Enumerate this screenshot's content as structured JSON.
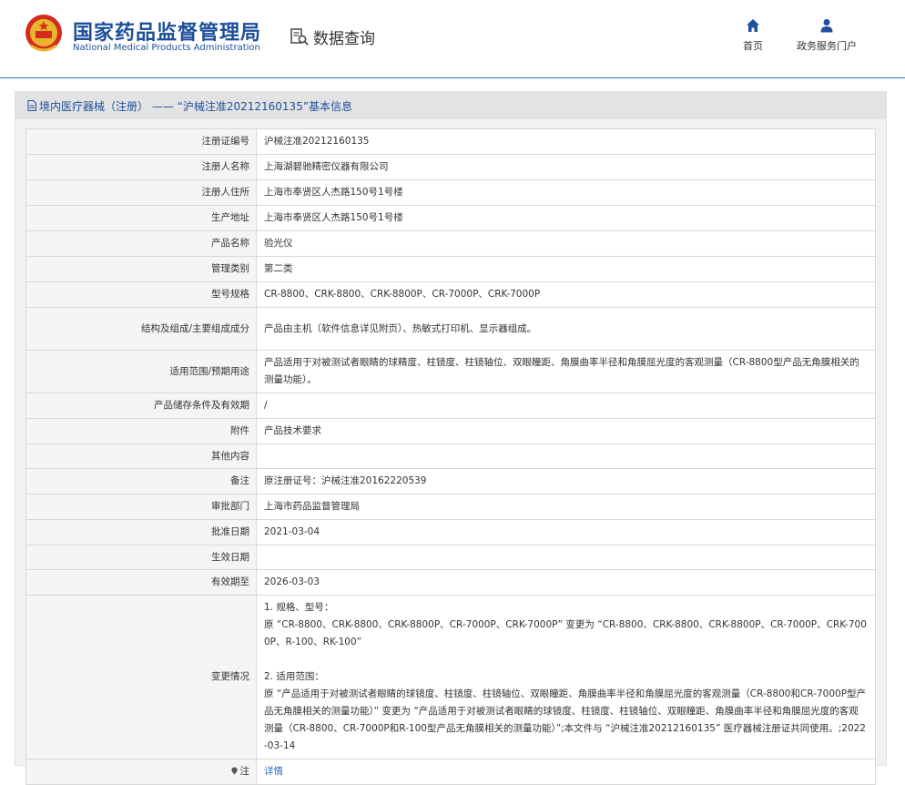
{
  "header": {
    "logo_cn": "国家药品监督管理局",
    "logo_en": "National Medical Products Administration",
    "query_label": "数据查询",
    "nav": [
      {
        "label": "首页",
        "icon": "home-icon"
      },
      {
        "label": "政务服务门户",
        "icon": "user-icon"
      }
    ]
  },
  "panel": {
    "title": "境内医疗器械（注册） —— “沪械注准20212160135”基本信息"
  },
  "rows": [
    {
      "label": "注册证编号",
      "value": "沪械注准20212160135"
    },
    {
      "label": "注册人名称",
      "value": "上海湖碧驰精密仪器有限公司"
    },
    {
      "label": "注册人住所",
      "value": "上海市奉贤区人杰路150号1号楼"
    },
    {
      "label": "生产地址",
      "value": "上海市奉贤区人杰路150号1号楼"
    },
    {
      "label": "产品名称",
      "value": "验光仪"
    },
    {
      "label": "管理类别",
      "value": "第二类"
    },
    {
      "label": "型号规格",
      "value": "CR-8800、CRK-8800、CRK-8800P、CR-7000P、CRK-7000P"
    },
    {
      "label": "结构及组成/主要组成成分",
      "value": "产品由主机（软件信息详见附页）、热敏式打印机、显示器组成。"
    },
    {
      "label": "适用范围/预期用途",
      "value": "产品适用于对被测试者眼睛的球精度、柱镜度、柱镜轴位、双眼瞳距、角膜曲率半径和角膜屈光度的客观测量（CR-8800型产品无角膜相关的测量功能）。"
    },
    {
      "label": "产品储存条件及有效期",
      "value": "/"
    },
    {
      "label": "附件",
      "value": "产品技术要求"
    },
    {
      "label": "其他内容",
      "value": ""
    },
    {
      "label": "备注",
      "value": "原注册证号：沪械注准20162220539"
    },
    {
      "label": "审批部门",
      "value": "上海市药品监督管理局"
    },
    {
      "label": "批准日期",
      "value": "2021-03-04"
    },
    {
      "label": "生效日期",
      "value": ""
    },
    {
      "label": "有效期至",
      "value": "2026-03-03"
    },
    {
      "label": "变更情况",
      "value": "1. 规格、型号：\n原 “CR-8800、CRK-8800、CRK-8800P、CR-7000P、CRK-7000P” 变更为 “CR-8800、CRK-8800、CRK-8800P、CR-7000P、CRK-7000P、R-100、RK-100”\n\n2. 适用范围：\n原 “产品适用于对被测试者眼睛的球镜度、柱镜度、柱镜轴位、双眼瞳距、角膜曲率半径和角膜屈光度的客观测量（CR-8800和CR-7000P型产品无角膜相关的测量功能）” 变更为 “产品适用于对被测试者眼睛的球镜度、柱镜度、柱镜轴位、双眼瞳距、角膜曲率半径和角膜屈光度的客观测量（CR-8800、CR-7000P和R-100型产品无角膜相关的测量功能）”;本文件与 “沪械注准20212160135” 医疗器械注册证共同使用。;2022-03-14"
    }
  ],
  "note": {
    "label": "注",
    "link": "详情"
  }
}
